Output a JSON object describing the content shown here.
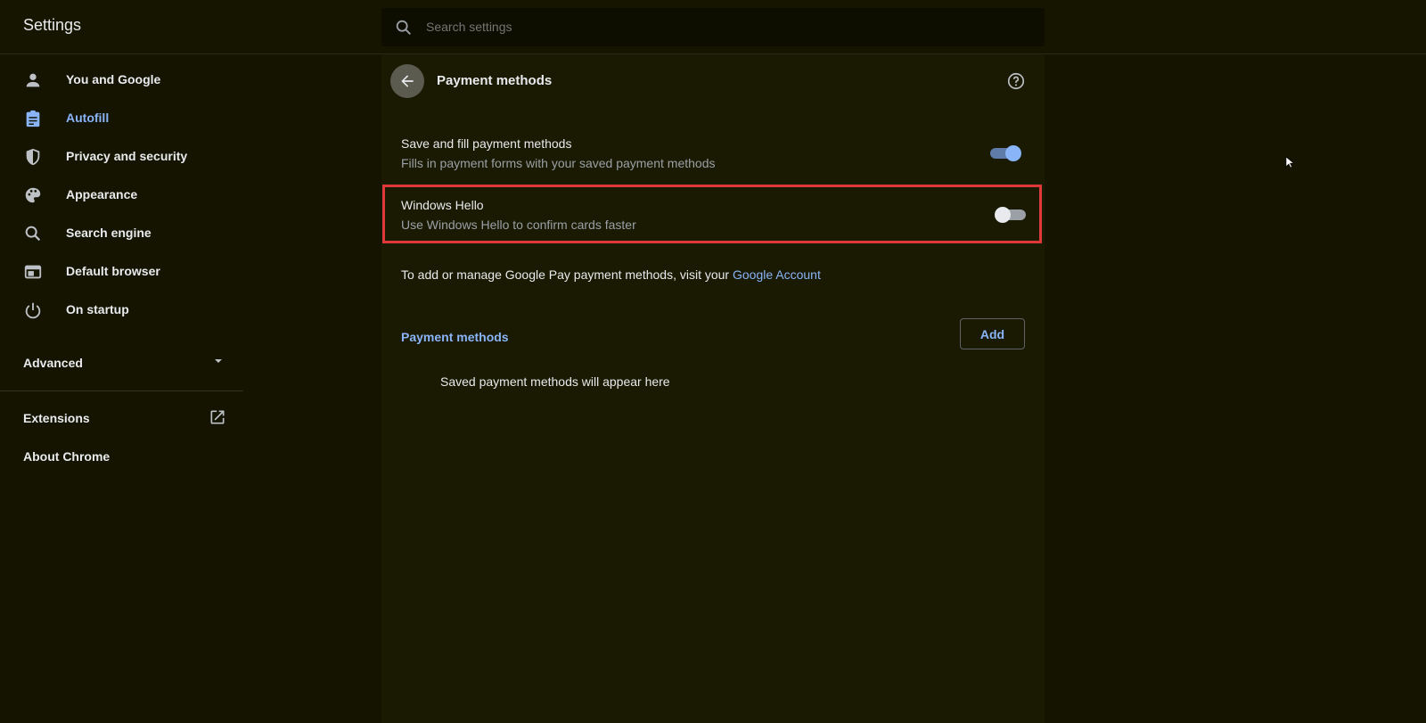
{
  "header": {
    "title": "Settings",
    "search_placeholder": "Search settings"
  },
  "sidebar": {
    "items": [
      {
        "label": "You and Google",
        "icon": "person-icon"
      },
      {
        "label": "Autofill",
        "icon": "clipboard-icon",
        "active": true
      },
      {
        "label": "Privacy and security",
        "icon": "shield-icon"
      },
      {
        "label": "Appearance",
        "icon": "palette-icon"
      },
      {
        "label": "Search engine",
        "icon": "search-icon"
      },
      {
        "label": "Default browser",
        "icon": "browser-window-icon"
      },
      {
        "label": "On startup",
        "icon": "power-icon"
      }
    ],
    "advanced_label": "Advanced",
    "extensions_label": "Extensions",
    "about_label": "About Chrome"
  },
  "main": {
    "page_title": "Payment methods",
    "save_fill": {
      "title": "Save and fill payment methods",
      "subtitle": "Fills in payment forms with your saved payment methods",
      "enabled": true
    },
    "windows_hello": {
      "title": "Windows Hello",
      "subtitle": "Use Windows Hello to confirm cards faster",
      "enabled": false
    },
    "google_pay_text": "To add or manage Google Pay payment methods, visit your",
    "google_account_link": "Google Account",
    "section_heading": "Payment methods",
    "add_button": "Add",
    "empty_message": "Saved payment methods will appear here"
  },
  "colors": {
    "background": "#141400",
    "accent": "#8ab4f8",
    "highlight": "#e03838"
  }
}
